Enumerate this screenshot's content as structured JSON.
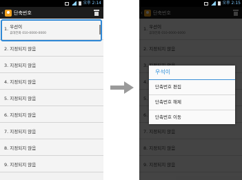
{
  "statusbar": {
    "time_left": "오후 2:14",
    "time_right": "오후 2:15"
  },
  "appbar": {
    "title": "단축번호",
    "back_icon": "back-chevron-icon",
    "trash_icon": "trash-icon"
  },
  "list": {
    "first": {
      "number": "1.",
      "name": "우선이",
      "phone_line": "휴대전화  010-0000-0000"
    },
    "items": [
      {
        "label": "2. 지정되지 않음"
      },
      {
        "label": "3. 지정되지 않음"
      },
      {
        "label": "4. 지정되지 않음"
      },
      {
        "label": "5. 지정되지 않음"
      },
      {
        "label": "6. 지정되지 않음"
      },
      {
        "label": "7. 지정되지 않음"
      },
      {
        "label": "8. 지정되지 않음"
      },
      {
        "label": "9. 지정되지 않음"
      }
    ]
  },
  "dialog": {
    "title": "우석이",
    "options": [
      "단축번호 편집",
      "단축번호 해제",
      "단축번호 이동"
    ]
  },
  "colors": {
    "highlight": "#2d87d6",
    "dialog_title": "#2e8ed8",
    "arrow": "#9a9a9a"
  }
}
